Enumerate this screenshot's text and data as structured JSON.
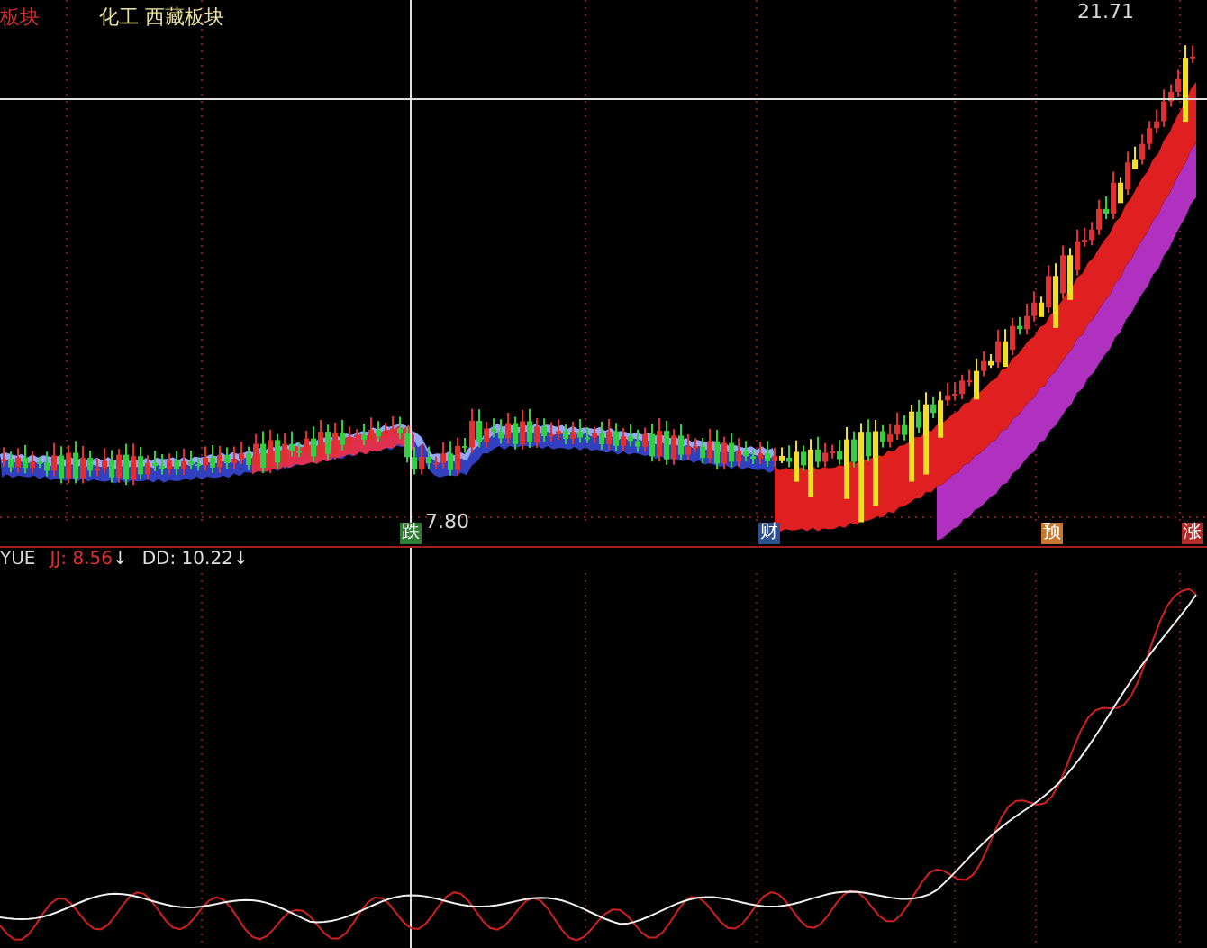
{
  "main_chart": {
    "sector_label": "板块",
    "sectors": "化工 西藏板块",
    "high_label": "21.71",
    "low_label": "7.80"
  },
  "event_markers": [
    {
      "text": "跌",
      "color": "#2f7d32"
    },
    {
      "text": "财",
      "color": "#2b4f8f"
    },
    {
      "text": "预",
      "color": "#c8782c"
    },
    {
      "text": "涨",
      "color": "#b02a2a"
    }
  ],
  "indicator": {
    "name": "YUE",
    "values": [
      {
        "label": "JJ: 8.56",
        "color": "#e03030",
        "arrow": "↓"
      },
      {
        "label": "DD: 10.22",
        "color": "#e0e0e0",
        "arrow": "↓"
      }
    ]
  }
}
